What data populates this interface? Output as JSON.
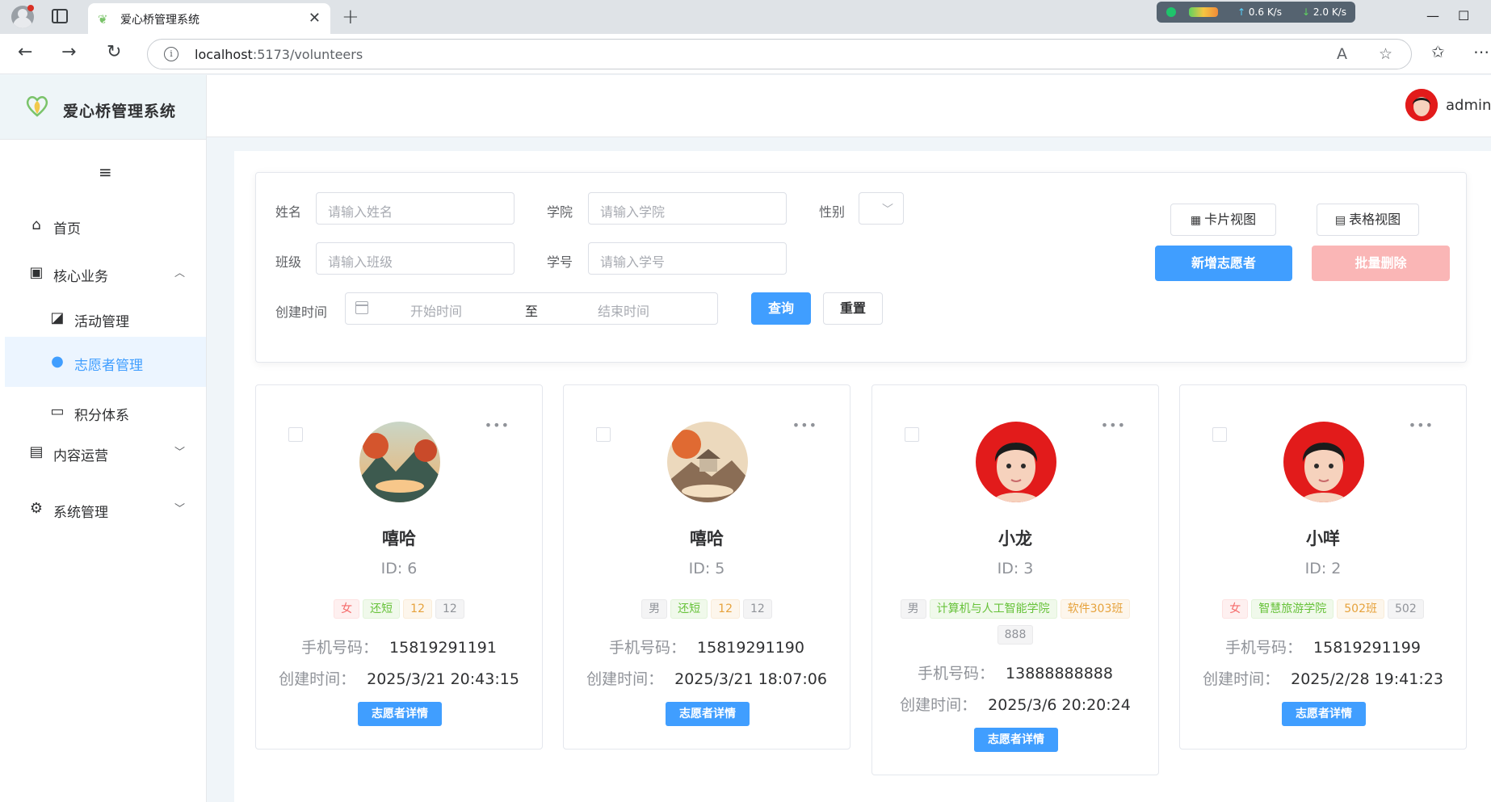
{
  "browser": {
    "tab_title": "爱心桥管理系统",
    "url_host": "localhost",
    "url_path": ":5173/volunteers",
    "net_up": "0.6",
    "net_down": "2.0",
    "net_unit": "K/s"
  },
  "app": {
    "brand": "爱心桥管理系统",
    "user": "admin"
  },
  "sidebar": {
    "items": [
      {
        "label": "首页"
      },
      {
        "label": "核心业务"
      },
      {
        "label": "活动管理"
      },
      {
        "label": "志愿者管理"
      },
      {
        "label": "积分体系"
      },
      {
        "label": "内容运营"
      },
      {
        "label": "系统管理"
      }
    ]
  },
  "filter": {
    "name_label": "姓名",
    "name_placeholder": "请输入姓名",
    "college_label": "学院",
    "college_placeholder": "请输入学院",
    "gender_label": "性别",
    "class_label": "班级",
    "class_placeholder": "请输入班级",
    "sid_label": "学号",
    "sid_placeholder": "请输入学号",
    "time_label": "创建时间",
    "time_start": "开始时间",
    "time_sep": "至",
    "time_end": "结束时间",
    "query": "查询",
    "reset": "重置",
    "card_view": "卡片视图",
    "table_view": "表格视图",
    "add": "新增志愿者",
    "batch_delete": "批量删除"
  },
  "card_labels": {
    "phone": "手机号码：",
    "created": "创建时间：",
    "detail": "志愿者详情"
  },
  "cards": [
    {
      "name": "嘻哈",
      "id": "ID: 6",
      "tags": [
        "女",
        "还短",
        "12",
        "12"
      ],
      "phone": "15819291191",
      "created": "2025/3/21 20:43:15"
    },
    {
      "name": "嘻哈",
      "id": "ID: 5",
      "tags": [
        "男",
        "还短",
        "12",
        "12"
      ],
      "phone": "15819291190",
      "created": "2025/3/21 18:07:06"
    },
    {
      "name": "小龙",
      "id": "ID: 3",
      "tags": [
        "男",
        "计算机与人工智能学院",
        "软件303班",
        "888"
      ],
      "phone": "13888888888",
      "created": "2025/3/6 20:20:24"
    },
    {
      "name": "小咩",
      "id": "ID: 2",
      "tags": [
        "女",
        "智慧旅游学院",
        "502班",
        "502"
      ],
      "phone": "15819291199",
      "created": "2025/2/28 19:41:23"
    }
  ],
  "colors": {
    "primary": "#409eff",
    "danger_light": "#fab6b6",
    "menu_active_bg": "#ecf5ff"
  }
}
